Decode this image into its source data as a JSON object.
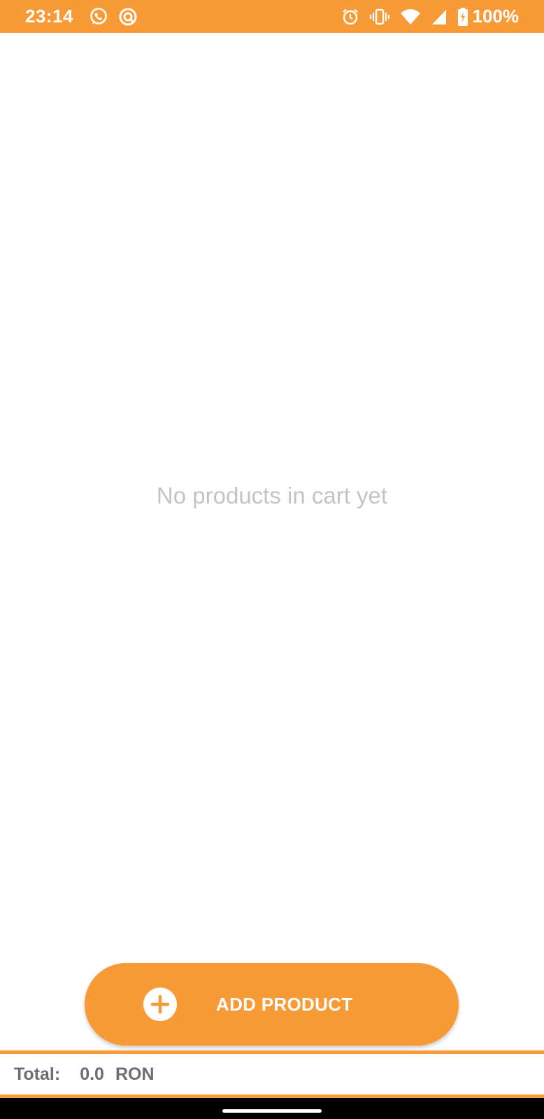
{
  "status_bar": {
    "time": "23:14",
    "left_icons": [
      "whatsapp-icon",
      "notification-app-icon"
    ],
    "right_icons": [
      "alarm-icon",
      "vibrate-icon",
      "wifi-icon",
      "cell-signal-icon",
      "battery-charging-icon"
    ],
    "battery": "100%"
  },
  "cart": {
    "empty_message": "No products in cart yet"
  },
  "add_button": {
    "label": "ADD PRODUCT",
    "icon": "plus-circle-icon"
  },
  "total": {
    "label": "Total:",
    "value": "0.0",
    "currency": "RON"
  },
  "colors": {
    "accent": "#F89A36",
    "empty_text": "#C4C4C4",
    "total_text": "#6E6E6E"
  }
}
